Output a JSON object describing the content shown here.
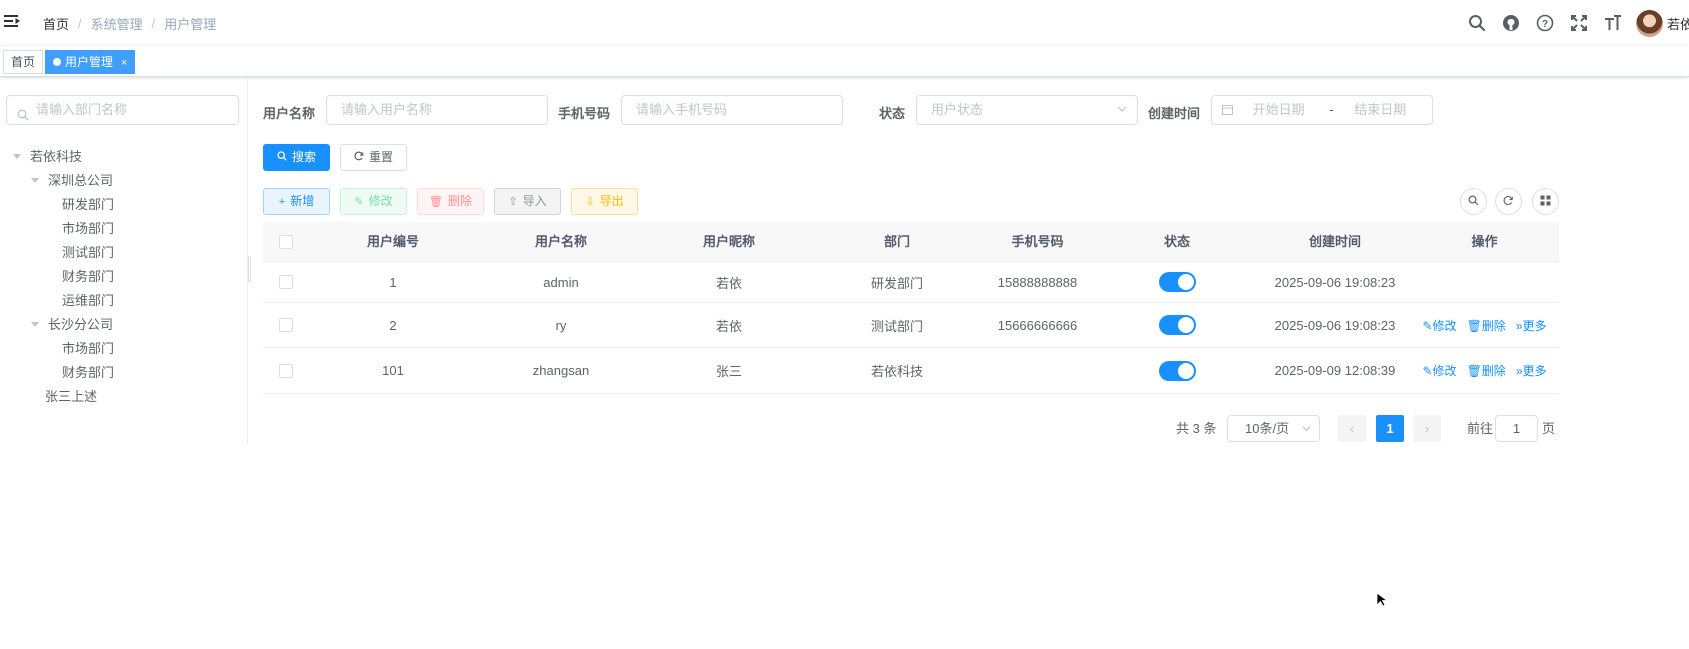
{
  "breadcrumb": [
    "首页",
    "系统管理",
    "用户管理"
  ],
  "header": {
    "user_name": "若依"
  },
  "tags": [
    {
      "label": "首页"
    },
    {
      "label": "用户管理",
      "close": "×"
    }
  ],
  "dept": {
    "placeholder": "请输入部门名称",
    "tree": [
      {
        "label": "若依科技"
      },
      {
        "label": "深圳总公司"
      },
      {
        "label": "研发部门"
      },
      {
        "label": "市场部门"
      },
      {
        "label": "测试部门"
      },
      {
        "label": "财务部门"
      },
      {
        "label": "运维部门"
      },
      {
        "label": "长沙分公司"
      },
      {
        "label": "市场部门"
      },
      {
        "label": "财务部门"
      },
      {
        "label": "张三上述"
      }
    ]
  },
  "search": {
    "username_label": "用户名称",
    "username_placeholder": "请输入用户名称",
    "phone_label": "手机号码",
    "phone_placeholder": "请输入手机号码",
    "status_label": "状态",
    "status_placeholder": "用户状态",
    "time_label": "创建时间",
    "start_placeholder": "开始日期",
    "range_sep": "-",
    "end_placeholder": "结束日期",
    "search_btn": "搜索",
    "reset_btn": "重置"
  },
  "toolbar": {
    "add": "新增",
    "edit": "修改",
    "delete": "删除",
    "import": "导入",
    "export": "导出"
  },
  "table": {
    "columns": [
      "用户编号",
      "用户名称",
      "用户昵称",
      "部门",
      "手机号码",
      "状态",
      "创建时间",
      "操作"
    ],
    "rows": [
      {
        "id": "1",
        "username": "admin",
        "nickname": "若依",
        "dept": "研发部门",
        "phone": "15888888888",
        "status_on": true,
        "created": "2025-09-06 19:08:23",
        "ops": []
      },
      {
        "id": "2",
        "username": "ry",
        "nickname": "若依",
        "dept": "测试部门",
        "phone": "15666666666",
        "status_on": true,
        "created": "2025-09-06 19:08:23",
        "ops": [
          "修改",
          "删除",
          "更多"
        ]
      },
      {
        "id": "101",
        "username": "zhangsan",
        "nickname": "张三",
        "dept": "若依科技",
        "phone": "",
        "status_on": true,
        "created": "2025-09-09 12:08:39",
        "ops": [
          "修改",
          "删除",
          "更多"
        ]
      }
    ]
  },
  "pagination": {
    "total": "共 3 条",
    "page_size": "10条/页",
    "current": "1",
    "goto_prefix": "前往",
    "goto_value": "1",
    "goto_suffix": "页"
  },
  "colors": {
    "primary": "#1890ff",
    "tag_active": "#409eff"
  }
}
